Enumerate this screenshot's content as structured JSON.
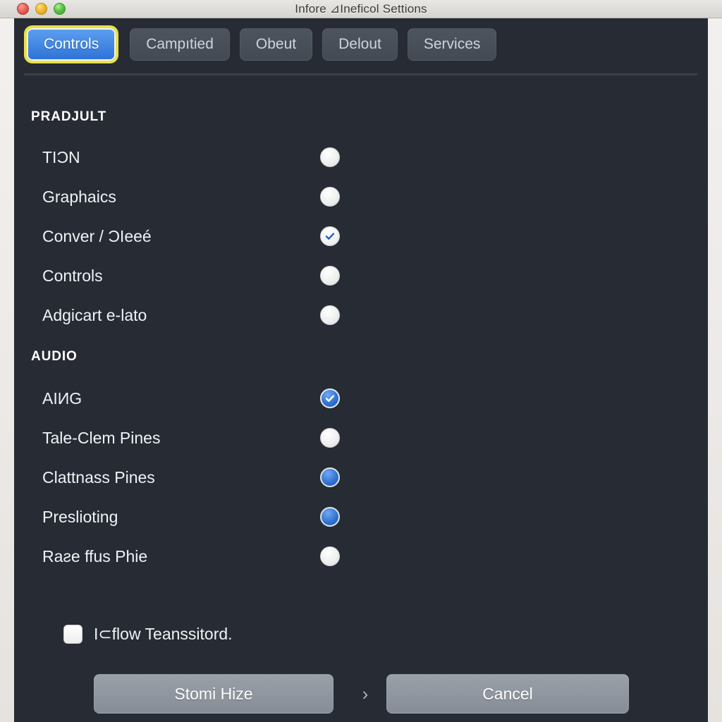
{
  "window": {
    "title": "Infore ⊿Ineficol Settions",
    "traffic_lights": [
      "close-button",
      "minimize-button",
      "zoom-button"
    ]
  },
  "tabs": [
    {
      "label": "Controls",
      "selected": true
    },
    {
      "label": "Campıtied",
      "selected": false
    },
    {
      "label": "Obeut",
      "selected": false
    },
    {
      "label": "Delout",
      "selected": false
    },
    {
      "label": "Services",
      "selected": false
    }
  ],
  "sections": [
    {
      "title": "PRADJULT",
      "rows": [
        {
          "label": "TIƆN",
          "state": "off"
        },
        {
          "label": "Graphaics",
          "state": "off"
        },
        {
          "label": "Conver / ƆIeeé",
          "state": "check-light"
        },
        {
          "label": "Controls",
          "state": "off"
        },
        {
          "label": "Adgicart e-lato",
          "state": "off"
        }
      ]
    },
    {
      "title": "AUDIO",
      "rows": [
        {
          "label": "AIИG",
          "state": "check-blue"
        },
        {
          "label": "Tale-Clem Pines",
          "state": "off"
        },
        {
          "label": "Clattnass Pines",
          "state": "on-blue"
        },
        {
          "label": "Preslioting",
          "state": "on-blue"
        },
        {
          "label": "Raƨe ffus Phie",
          "state": "off"
        }
      ]
    }
  ],
  "checkbox": {
    "label": "I⊂flow Teanssitord.",
    "checked": false
  },
  "footer": {
    "primary_label": "Stomi Hize",
    "chevron": "›",
    "secondary_label": "Cancel"
  },
  "colors": {
    "panel_background": "#262b34",
    "accent_blue": "#2f73d8",
    "focus_ring": "#e9e24a",
    "tab_inactive": "#474e58",
    "button_gray": "#8d949c",
    "text_primary": "#f0f2f5"
  }
}
